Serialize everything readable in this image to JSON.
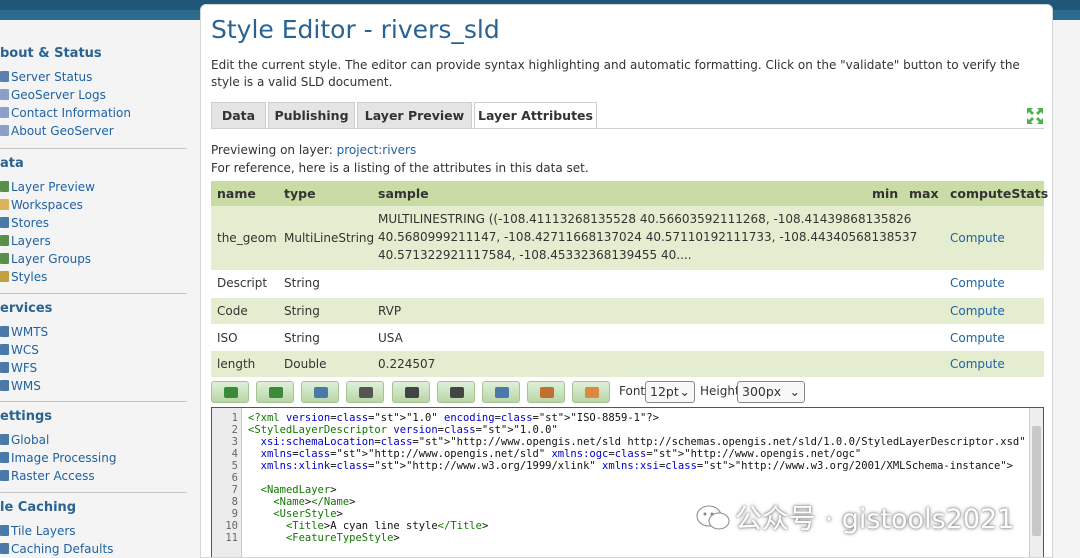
{
  "sidebar": {
    "sections": [
      {
        "title": "bout & Status",
        "items": [
          {
            "label": "Server Status",
            "icon": "server-status-icon",
            "color": "#5a7fb0"
          },
          {
            "label": "GeoServer Logs",
            "icon": "logs-icon",
            "color": "#8aa0c8"
          },
          {
            "label": "Contact Information",
            "icon": "contact-icon",
            "color": "#8aa0c8"
          },
          {
            "label": "About GeoServer",
            "icon": "about-icon",
            "color": "#8aa0c8"
          }
        ]
      },
      {
        "title": "ata",
        "items": [
          {
            "label": "Layer Preview",
            "icon": "layer-preview-icon",
            "color": "#5a8f4a"
          },
          {
            "label": "Workspaces",
            "icon": "workspaces-icon",
            "color": "#d9b35a"
          },
          {
            "label": "Stores",
            "icon": "stores-icon",
            "color": "#4a78a8"
          },
          {
            "label": "Layers",
            "icon": "layers-icon",
            "color": "#5a8f4a"
          },
          {
            "label": "Layer Groups",
            "icon": "layer-groups-icon",
            "color": "#5a8f4a"
          },
          {
            "label": "Styles",
            "icon": "styles-icon",
            "color": "#c0a040"
          }
        ]
      },
      {
        "title": "ervices",
        "items": [
          {
            "label": "WMTS",
            "icon": "wmts-icon",
            "color": "#4a78a8"
          },
          {
            "label": "WCS",
            "icon": "wcs-icon",
            "color": "#4a78a8"
          },
          {
            "label": "WFS",
            "icon": "wfs-icon",
            "color": "#4a78a8"
          },
          {
            "label": "WMS",
            "icon": "wms-icon",
            "color": "#4a78a8"
          }
        ]
      },
      {
        "title": "ettings",
        "items": [
          {
            "label": "Global",
            "icon": "global-icon",
            "color": "#4a78a8"
          },
          {
            "label": "Image Processing",
            "icon": "image-processing-icon",
            "color": "#4a78a8"
          },
          {
            "label": "Raster Access",
            "icon": "raster-access-icon",
            "color": "#4a78a8"
          }
        ]
      },
      {
        "title": "le Caching",
        "items": [
          {
            "label": "Tile Layers",
            "icon": "tile-layers-icon",
            "color": "#4a78a8"
          },
          {
            "label": "Caching Defaults",
            "icon": "caching-defaults-icon",
            "color": "#4a78a8"
          }
        ]
      }
    ]
  },
  "main": {
    "title": "Style Editor - rivers_sld",
    "description": "Edit the current style. The editor can provide syntax highlighting and automatic formatting. Click on the \"validate\" button to verify the style is a valid SLD document.",
    "tabs": [
      {
        "label": "Data",
        "active": false
      },
      {
        "label": "Publishing",
        "active": false
      },
      {
        "label": "Layer Preview",
        "active": false
      },
      {
        "label": "Layer Attributes",
        "active": true
      }
    ],
    "previewing_prefix": "Previewing on layer:",
    "previewing_layer": "project:rivers",
    "reference_text": "For reference, here is a listing of the attributes in this data set.",
    "table": {
      "headers": {
        "name": "name",
        "type": "type",
        "sample": "sample",
        "min": "min",
        "max": "max",
        "computeStats": "computeStats"
      },
      "rows": [
        {
          "name": "the_geom",
          "type": "MultiLineString",
          "sample": [
            "MULTILINESTRING ((-108.41113268135528 40.56603592111268, -108.41439868135826",
            "40.5680999211147, -108.42711668137024 40.57110192111733, -108.44340568138537",
            "40.571322921117584, -108.45332368139455 40...."
          ],
          "compute": "Compute"
        },
        {
          "name": "Descript",
          "type": "String",
          "sample": [
            ""
          ],
          "compute": "Compute"
        },
        {
          "name": "Code",
          "type": "String",
          "sample": [
            "RVP"
          ],
          "compute": "Compute"
        },
        {
          "name": "ISO",
          "type": "String",
          "sample": [
            "USA"
          ],
          "compute": "Compute"
        },
        {
          "name": "length",
          "type": "Double",
          "sample": [
            "0.224507"
          ],
          "compute": "Compute"
        }
      ]
    },
    "toolbar": {
      "buttons": [
        {
          "name": "undo-button",
          "icon": "undo-icon",
          "color": "#3a8a3a"
        },
        {
          "name": "redo-button",
          "icon": "redo-icon",
          "color": "#3a8a3a"
        },
        {
          "name": "goto-line-button",
          "icon": "goto-line-icon",
          "color": "#4a78a8"
        },
        {
          "name": "reformat-button",
          "icon": "reformat-icon",
          "color": "#555555"
        },
        {
          "name": "search-button",
          "icon": "binoculars-icon",
          "color": "#444444"
        },
        {
          "name": "replace-button",
          "icon": "binoculars-replace-icon",
          "color": "#444444"
        },
        {
          "name": "legend-button",
          "icon": "legend-icon",
          "color": "#4a78a8"
        },
        {
          "name": "image-button",
          "icon": "image-icon",
          "color": "#c07030"
        },
        {
          "name": "color-button",
          "icon": "palette-icon",
          "color": "#d98a40"
        }
      ],
      "font_label": "Font",
      "font_value": "12pt",
      "height_label": "Height",
      "height_value": "300px"
    },
    "editor": {
      "line_numbers": [
        "1",
        "2",
        "3",
        "4",
        "5",
        "6",
        "7",
        "8",
        "9",
        "10",
        "11"
      ],
      "lines": [
        "<?xml version=\"1.0\" encoding=\"ISO-8859-1\"?>",
        "<StyledLayerDescriptor version=\"1.0.0\"",
        "  xsi:schemaLocation=\"http://www.opengis.net/sld http://schemas.opengis.net/sld/1.0.0/StyledLayerDescriptor.xsd\"",
        "  xmlns=\"http://www.opengis.net/sld\" xmlns:ogc=\"http://www.opengis.net/ogc\"",
        "  xmlns:xlink=\"http://www.w3.org/1999/xlink\" xmlns:xsi=\"http://www.w3.org/2001/XMLSchema-instance\">",
        "",
        "  <NamedLayer>",
        "    <Name></Name>",
        "    <UserStyle>",
        "      <Title>A cyan line style</Title>",
        "      <FeatureTypeStyle>"
      ]
    }
  },
  "watermark": "公众号 · gistools2021"
}
